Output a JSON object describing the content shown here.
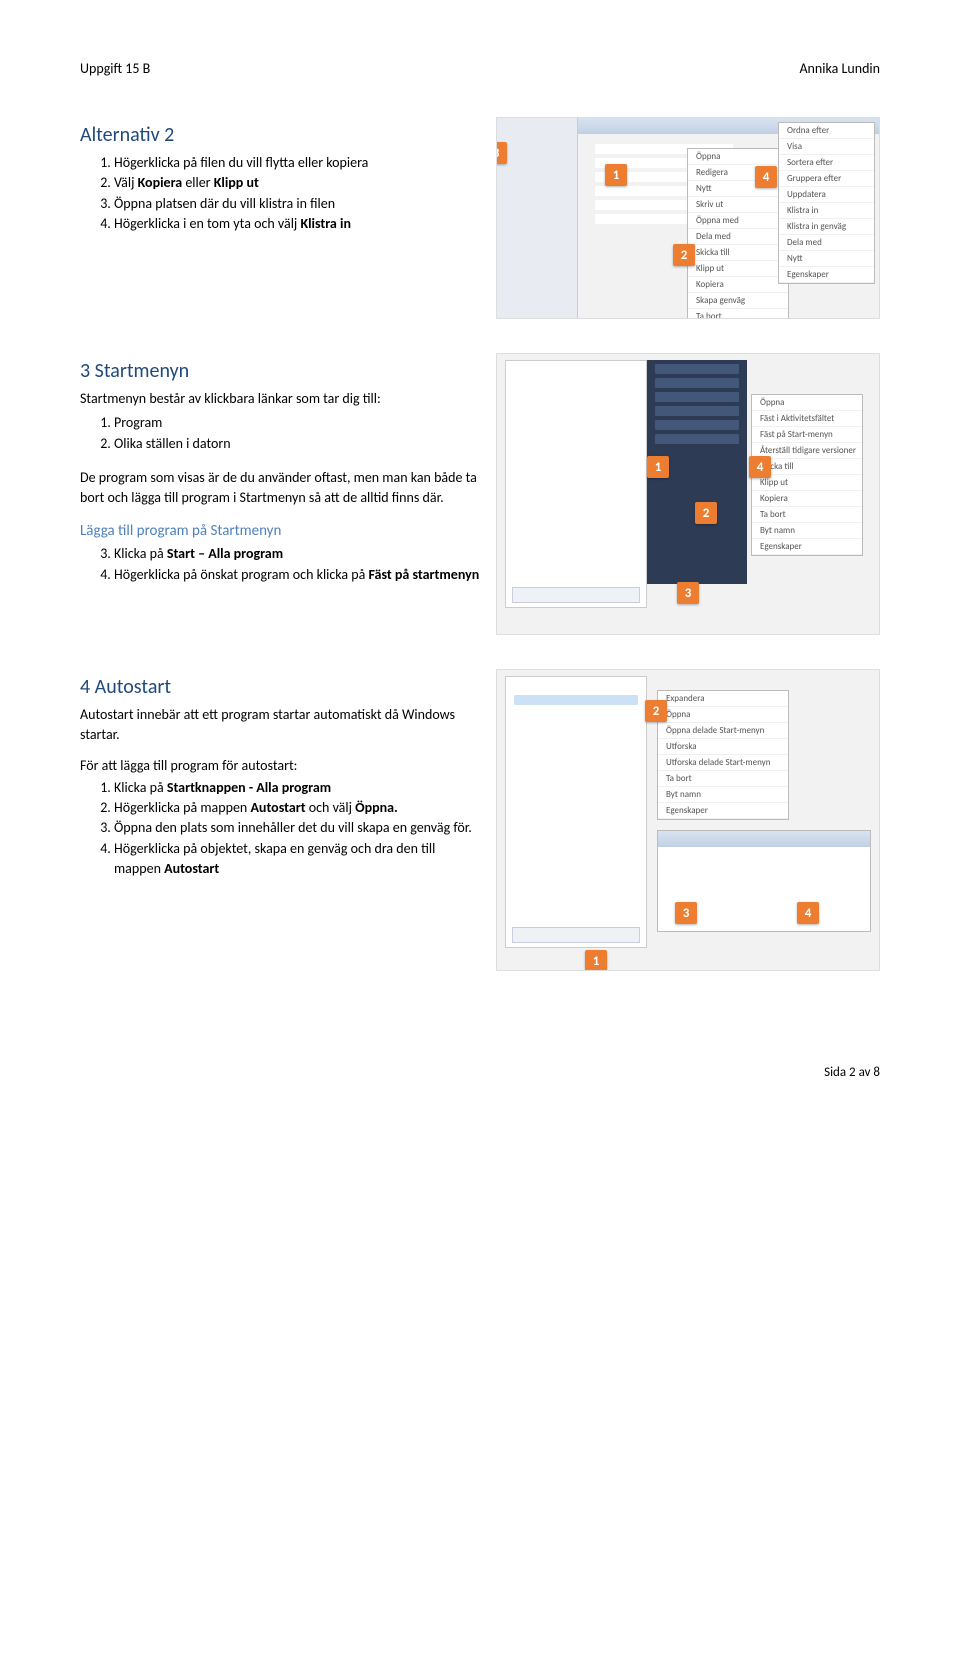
{
  "header": {
    "left": "Uppgift 15 B",
    "right": "Annika Lundin"
  },
  "alt2": {
    "heading": "Alternativ 2",
    "items": [
      "Högerklicka på filen du vill flytta eller kopiera",
      "Välj <b>Kopiera</b> eller <b>Klipp ut</b>",
      "Öppna platsen där du vill klistra in filen",
      "Högerklicka i en tom yta och välj <b>Klistra in</b>"
    ]
  },
  "startmenyn": {
    "heading": "3 Startmenyn",
    "intro": "Startmenyn består av klickbara länkar som tar dig till:",
    "list1": [
      "Program",
      "Olika ställen i datorn"
    ],
    "para": "De program som visas är de du använder oftast, men man kan både ta bort och lägga till program i Startmenyn så att de alltid finns där.",
    "subheading": "Lägga till program på Startmenyn",
    "list2": [
      "Klicka på <b>Start – Alla program</b>",
      "Högerklicka på önskat program och klicka på <b>Fäst på startmenyn</b>"
    ]
  },
  "autostart": {
    "heading": "4 Autostart",
    "para1": "Autostart innebär att ett program startar automatiskt då Windows startar.",
    "intro2": "För att lägga till program för autostart:",
    "list": [
      "Klicka på <b>Startknappen - Alla program</b>",
      "Högerklicka på mappen <b>Autostart</b> och välj <b>Öppna.</b>",
      "Öppna den plats som innehåller det du vill skapa en genväg för.",
      "Högerklicka på objektet, skapa en genväg och dra den till mappen <b>Autostart</b>"
    ]
  },
  "footer": "Sida 2 av 8"
}
